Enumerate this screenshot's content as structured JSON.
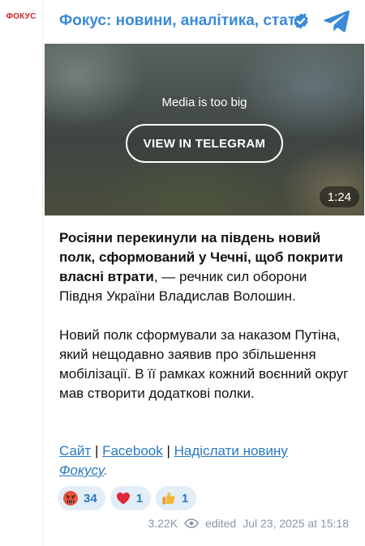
{
  "channel": {
    "avatar_text": "ФОКУС",
    "title": "Фокус: новини, аналітика, статті",
    "icons": {
      "verified": "verified-badge-icon",
      "app": "telegram-icon"
    },
    "colors": {
      "title": "#3a8ad6",
      "avatar_brand": "#d2232a"
    }
  },
  "media": {
    "notice": "Media is too big",
    "button_label": "VIEW IN TELEGRAM",
    "duration": "1:24"
  },
  "message": {
    "paragraph1_bold": "Росіяни перекинули на південь новий полк, сформований у Чечні, щоб покрити власні втрати",
    "paragraph1_rest": ", — речник сил оборони Півдня України Владислав Волошин.",
    "paragraph2": "Новий полк сформували за наказом Путіна, який нещодавно заявив про збільшення мобілізації. В її рамках кожний воєнний округ мав створити додаткові полки.",
    "links": {
      "site": "Сайт",
      "separator1": " | ",
      "facebook": "Facebook",
      "separator2": " | ",
      "submit_news": "Надіслати новину",
      "focus": "Фокусу",
      "end": "."
    }
  },
  "reactions": [
    {
      "emoji": "angry-face-icon",
      "count": "34"
    },
    {
      "emoji": "red-heart-icon",
      "count": "1"
    },
    {
      "emoji": "thumbs-up-icon",
      "count": "1"
    }
  ],
  "footer": {
    "views": "3.22K",
    "edited_label": "edited",
    "timestamp": "Jul 23, 2025 at 15:18",
    "colors": {
      "link": "#2a7ac2",
      "meta": "#8a97a3"
    }
  }
}
